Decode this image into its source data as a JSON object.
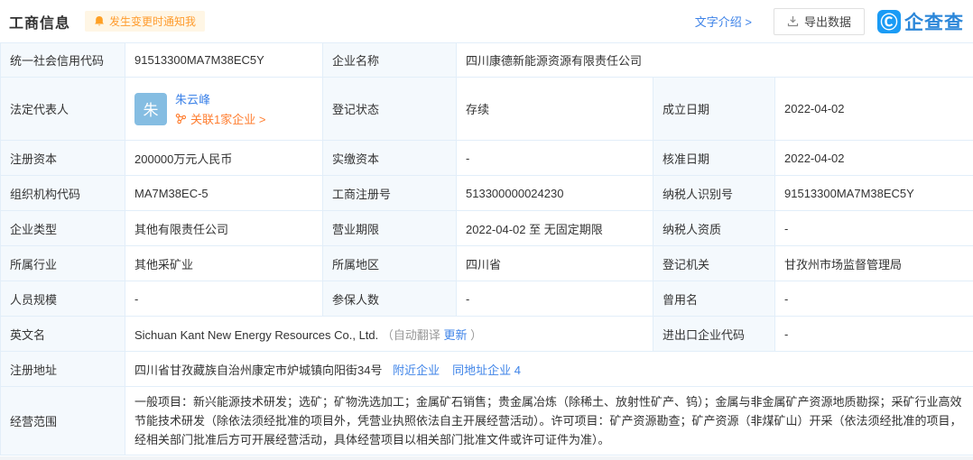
{
  "header": {
    "title": "工商信息",
    "notify_badge": "发生变更时通知我",
    "text_intro_link": "文字介绍 >",
    "export_label": "导出数据",
    "brand": "企查查"
  },
  "colors": {
    "accent_blue": "#3e83e8",
    "brand_blue": "#1a9bf5",
    "orange": "#ff7d2f",
    "badge_bg": "#fff6e5",
    "label_cell_bg": "#f4f9fd",
    "table_border": "#e2eef9",
    "avatar_bg": "#85bde2"
  },
  "fields": {
    "credit_code": {
      "label": "统一社会信用代码",
      "value": "91513300MA7M38EC5Y"
    },
    "company_name": {
      "label": "企业名称",
      "value": "四川康德新能源资源有限责任公司"
    },
    "legal_rep": {
      "label": "法定代表人",
      "avatar_char": "朱",
      "value": "朱云峰",
      "related_link": "关联1家企业 >"
    },
    "reg_status": {
      "label": "登记状态",
      "value": "存续"
    },
    "establish_date": {
      "label": "成立日期",
      "value": "2022-04-02"
    },
    "reg_capital": {
      "label": "注册资本",
      "value": "200000万元人民币"
    },
    "paid_capital": {
      "label": "实缴资本",
      "value": "-"
    },
    "approval_date": {
      "label": "核准日期",
      "value": "2022-04-02"
    },
    "org_code": {
      "label": "组织机构代码",
      "value": "MA7M38EC-5"
    },
    "reg_number": {
      "label": "工商注册号",
      "value": "513300000024230"
    },
    "taxpayer_id": {
      "label": "纳税人识别号",
      "value": "91513300MA7M38EC5Y"
    },
    "company_type": {
      "label": "企业类型",
      "value": "其他有限责任公司"
    },
    "business_term": {
      "label": "营业期限",
      "value": "2022-04-02 至 无固定期限"
    },
    "taxpayer_qualification": {
      "label": "纳税人资质",
      "value": "-"
    },
    "industry": {
      "label": "所属行业",
      "value": "其他采矿业"
    },
    "region": {
      "label": "所属地区",
      "value": "四川省"
    },
    "reg_authority": {
      "label": "登记机关",
      "value": "甘孜州市场监督管理局"
    },
    "staff_size": {
      "label": "人员规模",
      "value": "-"
    },
    "insured_count": {
      "label": "参保人数",
      "value": "-"
    },
    "former_name": {
      "label": "曾用名",
      "value": "-"
    },
    "english_name": {
      "label": "英文名",
      "value": "Sichuan Kant New Energy Resources Co., Ltd.",
      "note_prefix": "（自动翻译 ",
      "update_link": "更新",
      "note_suffix": " ）"
    },
    "import_export_code": {
      "label": "进出口企业代码",
      "value": "-"
    },
    "reg_address": {
      "label": "注册地址",
      "value": "四川省甘孜藏族自治州康定市炉城镇向阳街34号",
      "nearby_link": "附近企业",
      "same_address_link": "同地址企业 4"
    },
    "business_scope": {
      "label": "经营范围",
      "value": "一般项目：新兴能源技术研发；选矿；矿物洗选加工；金属矿石销售；贵金属冶炼（除稀土、放射性矿产、钨）；金属与非金属矿产资源地质勘探；采矿行业高效节能技术研发（除依法须经批准的项目外，凭营业执照依法自主开展经营活动）。许可项目：矿产资源勘查；矿产资源（非煤矿山）开采（依法须经批准的项目，经相关部门批准后方可开展经营活动，具体经营项目以相关部门批准文件或许可证件为准）。"
    }
  }
}
